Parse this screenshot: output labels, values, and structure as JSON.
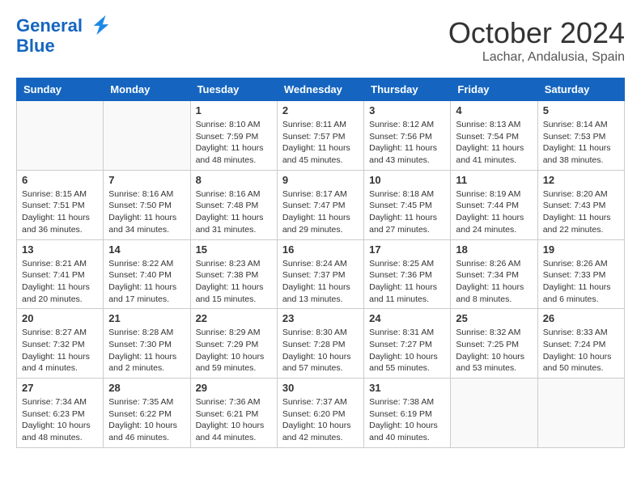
{
  "header": {
    "logo_line1": "General",
    "logo_line2": "Blue",
    "month": "October 2024",
    "location": "Lachar, Andalusia, Spain"
  },
  "weekdays": [
    "Sunday",
    "Monday",
    "Tuesday",
    "Wednesday",
    "Thursday",
    "Friday",
    "Saturday"
  ],
  "weeks": [
    [
      {
        "day": "",
        "sunrise": "",
        "sunset": "",
        "daylight": ""
      },
      {
        "day": "",
        "sunrise": "",
        "sunset": "",
        "daylight": ""
      },
      {
        "day": "1",
        "sunrise": "Sunrise: 8:10 AM",
        "sunset": "Sunset: 7:59 PM",
        "daylight": "Daylight: 11 hours and 48 minutes."
      },
      {
        "day": "2",
        "sunrise": "Sunrise: 8:11 AM",
        "sunset": "Sunset: 7:57 PM",
        "daylight": "Daylight: 11 hours and 45 minutes."
      },
      {
        "day": "3",
        "sunrise": "Sunrise: 8:12 AM",
        "sunset": "Sunset: 7:56 PM",
        "daylight": "Daylight: 11 hours and 43 minutes."
      },
      {
        "day": "4",
        "sunrise": "Sunrise: 8:13 AM",
        "sunset": "Sunset: 7:54 PM",
        "daylight": "Daylight: 11 hours and 41 minutes."
      },
      {
        "day": "5",
        "sunrise": "Sunrise: 8:14 AM",
        "sunset": "Sunset: 7:53 PM",
        "daylight": "Daylight: 11 hours and 38 minutes."
      }
    ],
    [
      {
        "day": "6",
        "sunrise": "Sunrise: 8:15 AM",
        "sunset": "Sunset: 7:51 PM",
        "daylight": "Daylight: 11 hours and 36 minutes."
      },
      {
        "day": "7",
        "sunrise": "Sunrise: 8:16 AM",
        "sunset": "Sunset: 7:50 PM",
        "daylight": "Daylight: 11 hours and 34 minutes."
      },
      {
        "day": "8",
        "sunrise": "Sunrise: 8:16 AM",
        "sunset": "Sunset: 7:48 PM",
        "daylight": "Daylight: 11 hours and 31 minutes."
      },
      {
        "day": "9",
        "sunrise": "Sunrise: 8:17 AM",
        "sunset": "Sunset: 7:47 PM",
        "daylight": "Daylight: 11 hours and 29 minutes."
      },
      {
        "day": "10",
        "sunrise": "Sunrise: 8:18 AM",
        "sunset": "Sunset: 7:45 PM",
        "daylight": "Daylight: 11 hours and 27 minutes."
      },
      {
        "day": "11",
        "sunrise": "Sunrise: 8:19 AM",
        "sunset": "Sunset: 7:44 PM",
        "daylight": "Daylight: 11 hours and 24 minutes."
      },
      {
        "day": "12",
        "sunrise": "Sunrise: 8:20 AM",
        "sunset": "Sunset: 7:43 PM",
        "daylight": "Daylight: 11 hours and 22 minutes."
      }
    ],
    [
      {
        "day": "13",
        "sunrise": "Sunrise: 8:21 AM",
        "sunset": "Sunset: 7:41 PM",
        "daylight": "Daylight: 11 hours and 20 minutes."
      },
      {
        "day": "14",
        "sunrise": "Sunrise: 8:22 AM",
        "sunset": "Sunset: 7:40 PM",
        "daylight": "Daylight: 11 hours and 17 minutes."
      },
      {
        "day": "15",
        "sunrise": "Sunrise: 8:23 AM",
        "sunset": "Sunset: 7:38 PM",
        "daylight": "Daylight: 11 hours and 15 minutes."
      },
      {
        "day": "16",
        "sunrise": "Sunrise: 8:24 AM",
        "sunset": "Sunset: 7:37 PM",
        "daylight": "Daylight: 11 hours and 13 minutes."
      },
      {
        "day": "17",
        "sunrise": "Sunrise: 8:25 AM",
        "sunset": "Sunset: 7:36 PM",
        "daylight": "Daylight: 11 hours and 11 minutes."
      },
      {
        "day": "18",
        "sunrise": "Sunrise: 8:26 AM",
        "sunset": "Sunset: 7:34 PM",
        "daylight": "Daylight: 11 hours and 8 minutes."
      },
      {
        "day": "19",
        "sunrise": "Sunrise: 8:26 AM",
        "sunset": "Sunset: 7:33 PM",
        "daylight": "Daylight: 11 hours and 6 minutes."
      }
    ],
    [
      {
        "day": "20",
        "sunrise": "Sunrise: 8:27 AM",
        "sunset": "Sunset: 7:32 PM",
        "daylight": "Daylight: 11 hours and 4 minutes."
      },
      {
        "day": "21",
        "sunrise": "Sunrise: 8:28 AM",
        "sunset": "Sunset: 7:30 PM",
        "daylight": "Daylight: 11 hours and 2 minutes."
      },
      {
        "day": "22",
        "sunrise": "Sunrise: 8:29 AM",
        "sunset": "Sunset: 7:29 PM",
        "daylight": "Daylight: 10 hours and 59 minutes."
      },
      {
        "day": "23",
        "sunrise": "Sunrise: 8:30 AM",
        "sunset": "Sunset: 7:28 PM",
        "daylight": "Daylight: 10 hours and 57 minutes."
      },
      {
        "day": "24",
        "sunrise": "Sunrise: 8:31 AM",
        "sunset": "Sunset: 7:27 PM",
        "daylight": "Daylight: 10 hours and 55 minutes."
      },
      {
        "day": "25",
        "sunrise": "Sunrise: 8:32 AM",
        "sunset": "Sunset: 7:25 PM",
        "daylight": "Daylight: 10 hours and 53 minutes."
      },
      {
        "day": "26",
        "sunrise": "Sunrise: 8:33 AM",
        "sunset": "Sunset: 7:24 PM",
        "daylight": "Daylight: 10 hours and 50 minutes."
      }
    ],
    [
      {
        "day": "27",
        "sunrise": "Sunrise: 7:34 AM",
        "sunset": "Sunset: 6:23 PM",
        "daylight": "Daylight: 10 hours and 48 minutes."
      },
      {
        "day": "28",
        "sunrise": "Sunrise: 7:35 AM",
        "sunset": "Sunset: 6:22 PM",
        "daylight": "Daylight: 10 hours and 46 minutes."
      },
      {
        "day": "29",
        "sunrise": "Sunrise: 7:36 AM",
        "sunset": "Sunset: 6:21 PM",
        "daylight": "Daylight: 10 hours and 44 minutes."
      },
      {
        "day": "30",
        "sunrise": "Sunrise: 7:37 AM",
        "sunset": "Sunset: 6:20 PM",
        "daylight": "Daylight: 10 hours and 42 minutes."
      },
      {
        "day": "31",
        "sunrise": "Sunrise: 7:38 AM",
        "sunset": "Sunset: 6:19 PM",
        "daylight": "Daylight: 10 hours and 40 minutes."
      },
      {
        "day": "",
        "sunrise": "",
        "sunset": "",
        "daylight": ""
      },
      {
        "day": "",
        "sunrise": "",
        "sunset": "",
        "daylight": ""
      }
    ]
  ]
}
